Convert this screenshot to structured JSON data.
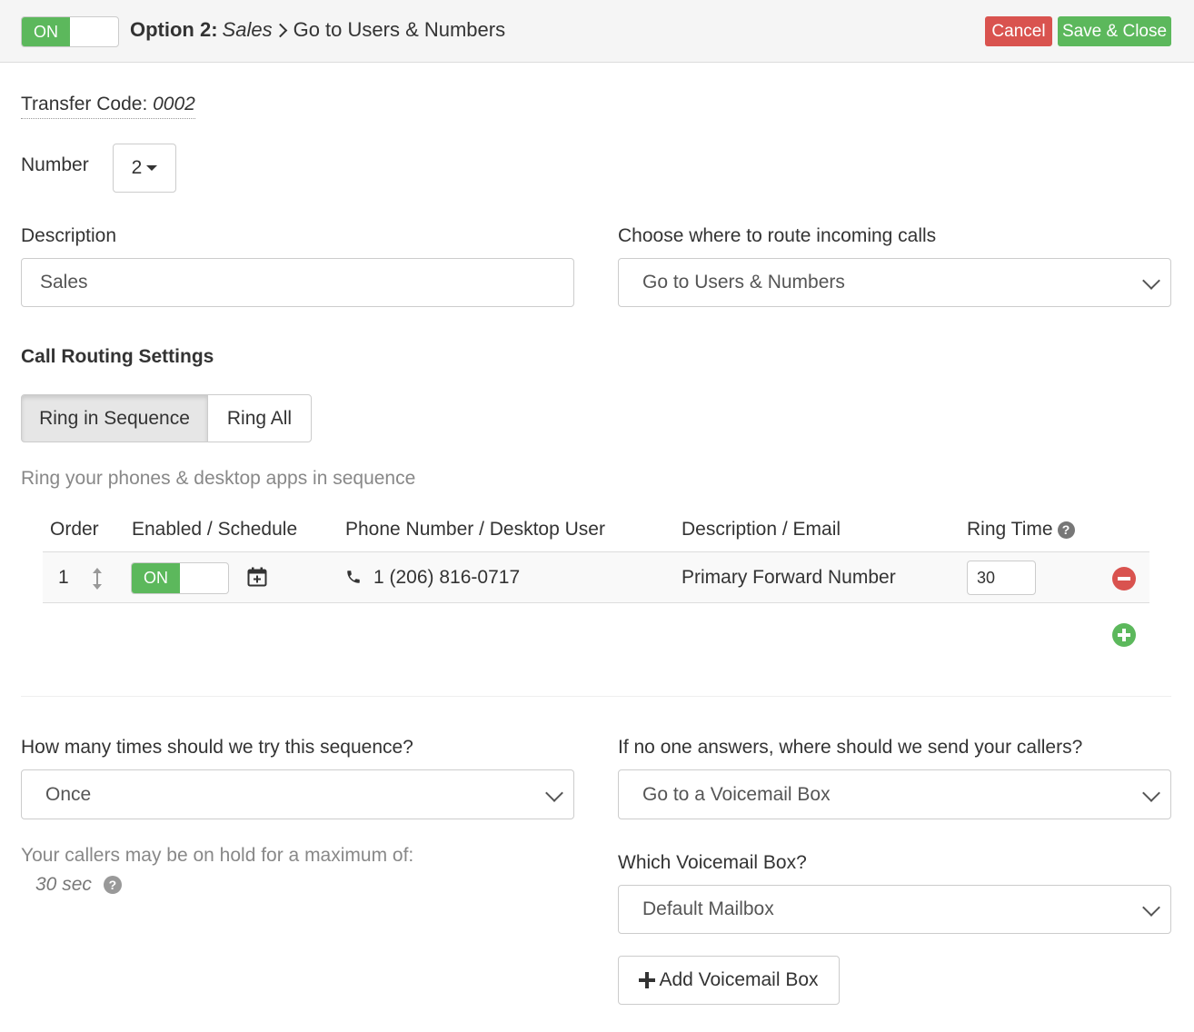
{
  "header": {
    "toggle_label": "ON",
    "title_prefix": "Option 2:",
    "title_name": "Sales",
    "title_separator": ">",
    "title_destination": "Go to Users & Numbers",
    "cancel_label": "Cancel",
    "save_label": "Save & Close"
  },
  "transfer": {
    "label": "Transfer Code:",
    "code": "0002"
  },
  "number": {
    "label": "Number",
    "value": "2"
  },
  "description": {
    "label": "Description",
    "value": "Sales"
  },
  "route": {
    "label": "Choose where to route incoming calls",
    "value": "Go to Users & Numbers"
  },
  "routing": {
    "heading": "Call Routing Settings",
    "modes": [
      "Ring in Sequence",
      "Ring All"
    ],
    "active_mode": "Ring in Sequence",
    "hint": "Ring your phones & desktop apps in sequence"
  },
  "table": {
    "headers": {
      "order": "Order",
      "enabled": "Enabled / Schedule",
      "phone": "Phone Number / Desktop User",
      "description": "Description / Email",
      "ring_time": "Ring Time"
    },
    "rows": [
      {
        "order": "1",
        "toggle": "ON",
        "phone": "1 (206) 816-0717",
        "description": "Primary Forward Number",
        "ring_time": "30"
      }
    ]
  },
  "attempts": {
    "label": "How many times should we try this sequence?",
    "value": "Once"
  },
  "hold": {
    "label": "Your callers may be on hold for a maximum of:",
    "value": "30 sec"
  },
  "no_answer": {
    "label": "If no one answers, where should we send your callers?",
    "value": "Go to a Voicemail Box"
  },
  "voicemail": {
    "label": "Which Voicemail Box?",
    "value": "Default Mailbox",
    "add_label": "Add Voicemail Box"
  },
  "colors": {
    "green": "#5cb85c",
    "red": "#d9534f",
    "header_bg": "#f5f5f5",
    "border": "#cccccc"
  },
  "icons": [
    "sort-arrows-icon",
    "calendar-plus-icon",
    "phone-icon",
    "question-circle-icon",
    "minus-circle-icon",
    "plus-circle-icon",
    "plus-icon",
    "chevron-down-icon",
    "caret-down-icon"
  ]
}
